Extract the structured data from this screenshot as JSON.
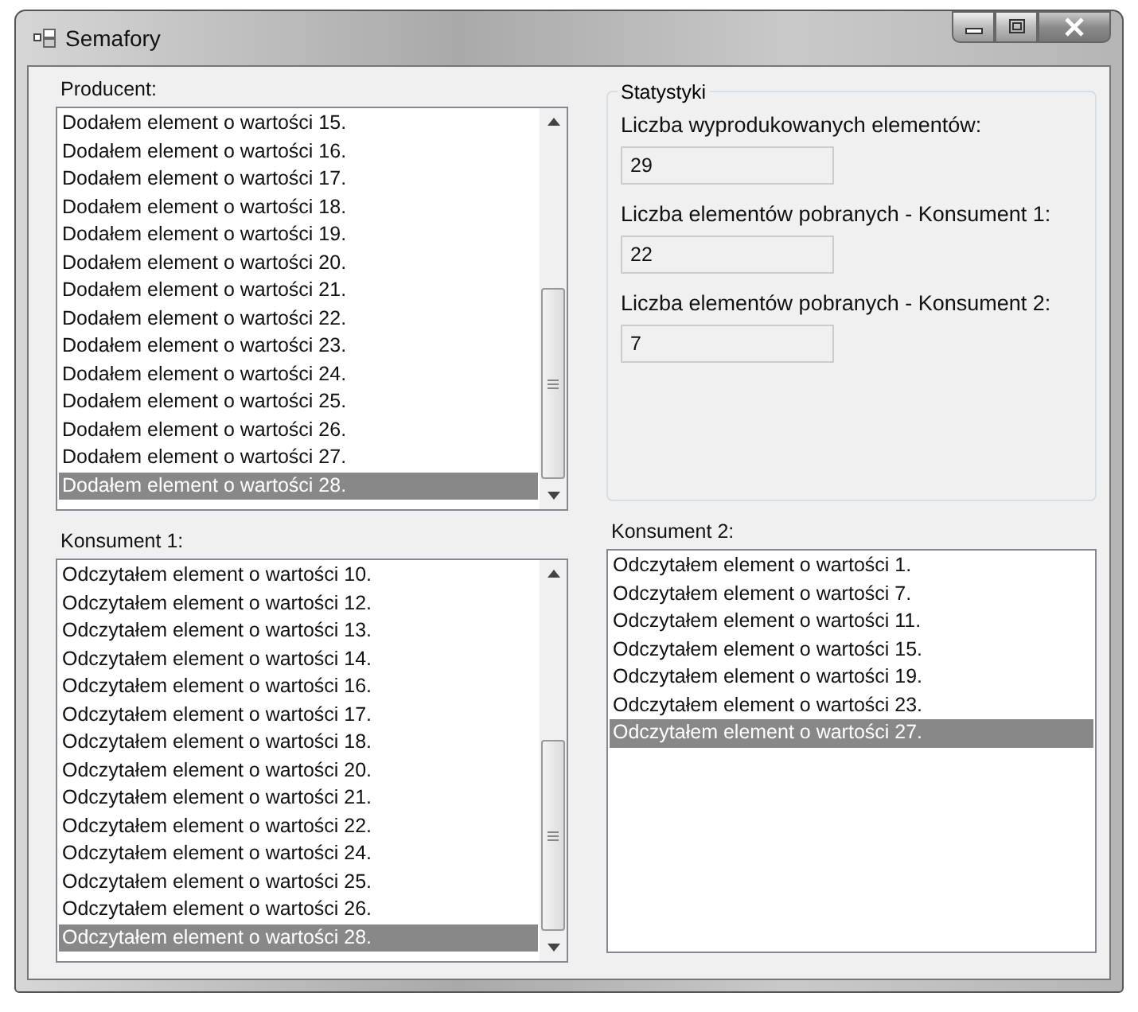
{
  "window": {
    "title": "Semafory"
  },
  "producer": {
    "label": "Producent:",
    "scrollable": true,
    "items": [
      {
        "text": "Dodałem element o wartości 15.",
        "selected": false
      },
      {
        "text": "Dodałem element o wartości 16.",
        "selected": false
      },
      {
        "text": "Dodałem element o wartości 17.",
        "selected": false
      },
      {
        "text": "Dodałem element o wartości 18.",
        "selected": false
      },
      {
        "text": "Dodałem element o wartości 19.",
        "selected": false
      },
      {
        "text": "Dodałem element o wartości 20.",
        "selected": false
      },
      {
        "text": "Dodałem element o wartości 21.",
        "selected": false
      },
      {
        "text": "Dodałem element o wartości 22.",
        "selected": false
      },
      {
        "text": "Dodałem element o wartości 23.",
        "selected": false
      },
      {
        "text": "Dodałem element o wartości 24.",
        "selected": false
      },
      {
        "text": "Dodałem element o wartości 25.",
        "selected": false
      },
      {
        "text": "Dodałem element o wartości 26.",
        "selected": false
      },
      {
        "text": "Dodałem element o wartości 27.",
        "selected": false
      },
      {
        "text": "Dodałem element o wartości 28.",
        "selected": true
      }
    ]
  },
  "statistics": {
    "title": "Statystyki",
    "fields": [
      {
        "label": "Liczba wyprodukowanych elementów:",
        "value": "29"
      },
      {
        "label": "Liczba elementów pobranych - Konsument 1:",
        "value": "22"
      },
      {
        "label": "Liczba elementów pobranych - Konsument 2:",
        "value": "7"
      }
    ]
  },
  "consumer_1": {
    "label": "Konsument 1:",
    "scrollable": true,
    "items": [
      {
        "text": "Odczytałem element o wartości 10.",
        "selected": false
      },
      {
        "text": "Odczytałem element o wartości 12.",
        "selected": false
      },
      {
        "text": "Odczytałem element o wartości 13.",
        "selected": false
      },
      {
        "text": "Odczytałem element o wartości 14.",
        "selected": false
      },
      {
        "text": "Odczytałem element o wartości 16.",
        "selected": false
      },
      {
        "text": "Odczytałem element o wartości 17.",
        "selected": false
      },
      {
        "text": "Odczytałem element o wartości 18.",
        "selected": false
      },
      {
        "text": "Odczytałem element o wartości 20.",
        "selected": false
      },
      {
        "text": "Odczytałem element o wartości 21.",
        "selected": false
      },
      {
        "text": "Odczytałem element o wartości 22.",
        "selected": false
      },
      {
        "text": "Odczytałem element o wartości 24.",
        "selected": false
      },
      {
        "text": "Odczytałem element o wartości 25.",
        "selected": false
      },
      {
        "text": "Odczytałem element o wartości 26.",
        "selected": false
      },
      {
        "text": "Odczytałem element o wartości 28.",
        "selected": true
      }
    ]
  },
  "consumer_2": {
    "label": "Konsument 2:",
    "scrollable": false,
    "items": [
      {
        "text": "Odczytałem element o wartości 1.",
        "selected": false
      },
      {
        "text": "Odczytałem element o wartości 7.",
        "selected": false
      },
      {
        "text": "Odczytałem element o wartości 11.",
        "selected": false
      },
      {
        "text": "Odczytałem element o wartości 15.",
        "selected": false
      },
      {
        "text": "Odczytałem element o wartości 19.",
        "selected": false
      },
      {
        "text": "Odczytałem element o wartości 23.",
        "selected": false
      },
      {
        "text": "Odczytałem element o wartości 27.",
        "selected": true
      }
    ]
  }
}
